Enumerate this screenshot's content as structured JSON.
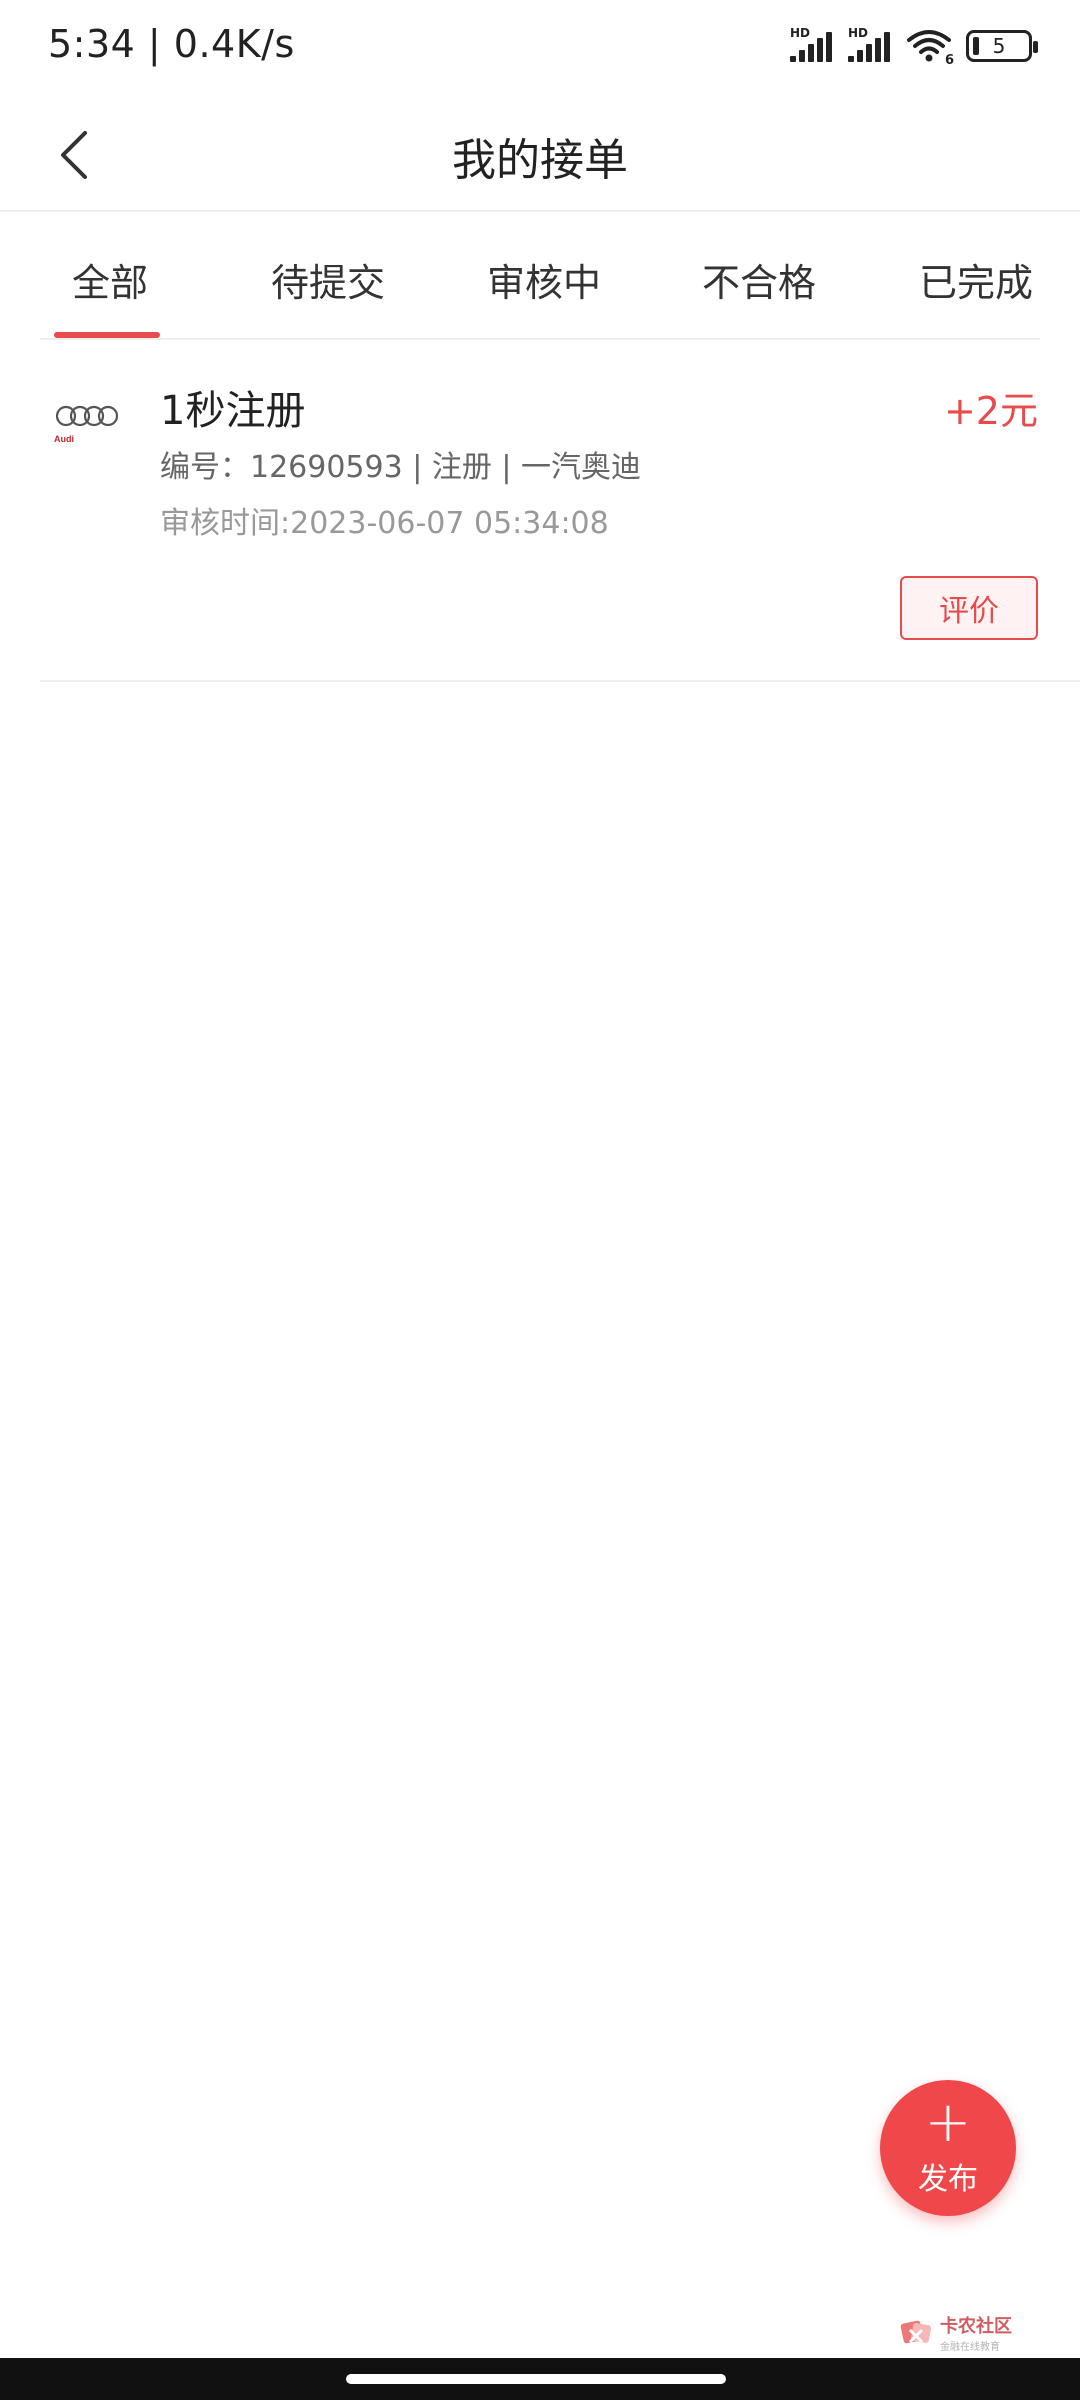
{
  "status_bar": {
    "time_speed": "5:34 | 0.4K/s",
    "signal_label_1": "HD",
    "signal_label_2": "HD",
    "wifi_label": "6",
    "battery_level": "5"
  },
  "header": {
    "title": "我的接单"
  },
  "tabs": [
    {
      "label": "全部",
      "active": true
    },
    {
      "label": "待提交",
      "active": false
    },
    {
      "label": "审核中",
      "active": false
    },
    {
      "label": "不合格",
      "active": false
    },
    {
      "label": "已完成",
      "active": false
    }
  ],
  "orders": [
    {
      "logo_text": "Audi",
      "title": "1秒注册",
      "reward": "+2元",
      "meta": "编号：12690593 | 注册 | 一汽奥迪",
      "time": "审核时间:2023-06-07 05:34:08",
      "action": "评价"
    }
  ],
  "fab": {
    "plus": "+",
    "label": "发布"
  },
  "watermark": {
    "title": "卡农社区",
    "subtitle": "金融在线教育"
  },
  "colors": {
    "accent": "#e84b4b",
    "fab": "#f0474b"
  }
}
